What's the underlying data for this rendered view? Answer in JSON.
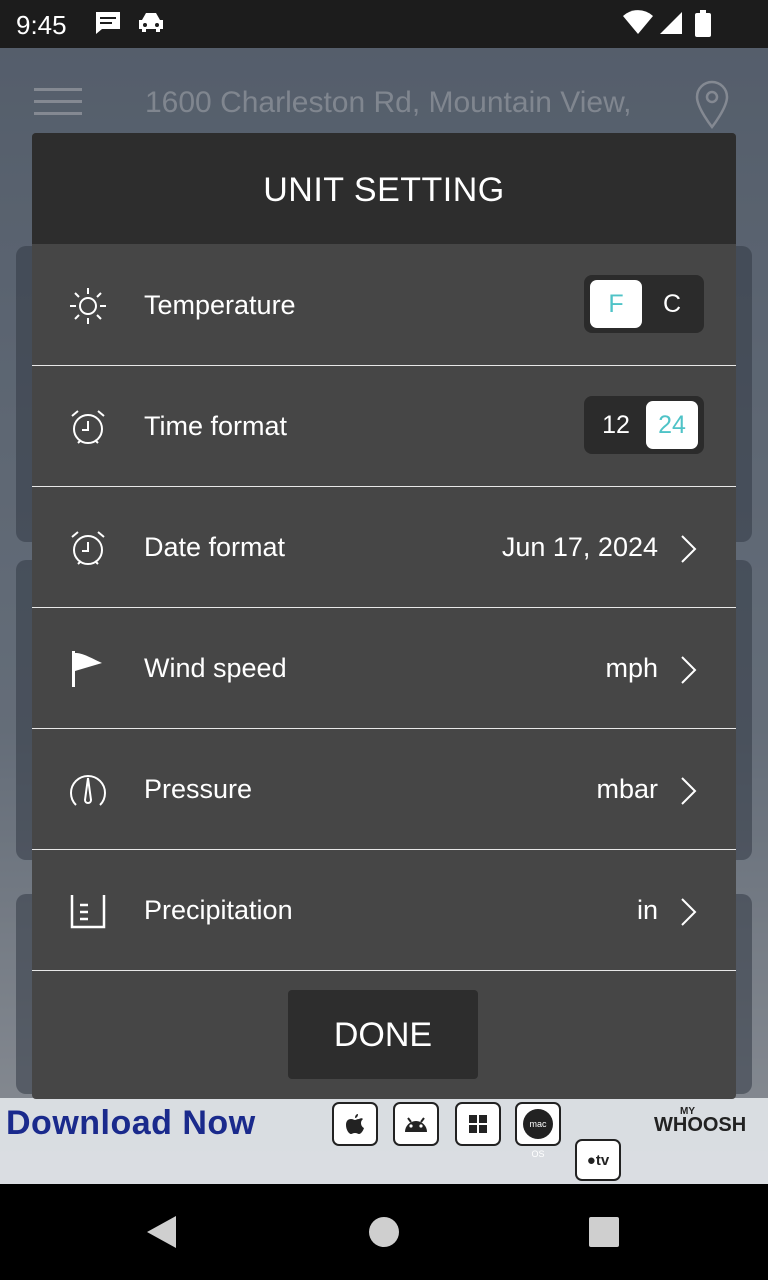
{
  "status_bar": {
    "time": "9:45"
  },
  "background": {
    "address": "1600 Charleston Rd, Mountain View,"
  },
  "dialog": {
    "title": "UNIT SETTING",
    "rows": [
      {
        "label": "Temperature",
        "icon": "sun-icon",
        "toggle": {
          "options": [
            "F",
            "C"
          ],
          "selected": "F"
        }
      },
      {
        "label": "Time format",
        "icon": "alarm-clock-icon",
        "toggle": {
          "options": [
            "12",
            "24"
          ],
          "selected": "24"
        }
      },
      {
        "label": "Date format",
        "icon": "alarm-clock-icon",
        "value": "Jun 17, 2024"
      },
      {
        "label": "Wind speed",
        "icon": "wind-flag-icon",
        "value": "mph"
      },
      {
        "label": "Pressure",
        "icon": "gauge-icon",
        "value": "mbar"
      },
      {
        "label": "Precipitation",
        "icon": "rain-gauge-icon",
        "value": "in"
      }
    ],
    "done_label": "DONE",
    "accent_color": "#4fc3c7"
  },
  "ad": {
    "text": "Download Now",
    "stores": [
      "apple-icon",
      "android-icon",
      "windows-icon",
      "macos-icon",
      "apple-tv-icon"
    ],
    "macos_label": "mac OS",
    "appletv_label": "tv",
    "brand": "WHOOSH",
    "brand_prefix": "MY"
  }
}
